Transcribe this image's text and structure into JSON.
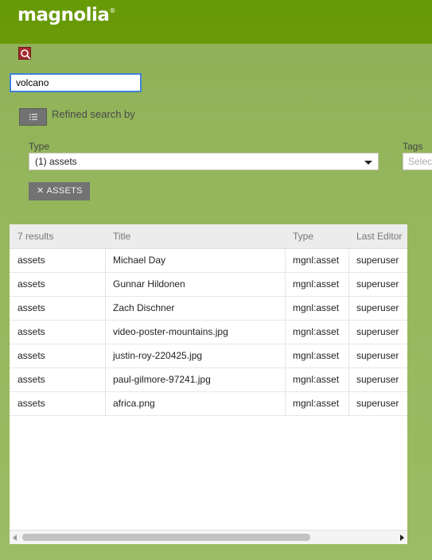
{
  "app": {
    "logo_text": "magnolia",
    "logo_mark": "®"
  },
  "search": {
    "value": "volcano"
  },
  "filters": {
    "toggle_icon": "list-icon",
    "refined_label": "Refined search by",
    "type_label": "Type",
    "type_value": "(1) assets",
    "tags_label": "Tags",
    "tags_placeholder": "Select",
    "active_chip": "ASSETS"
  },
  "results": {
    "columns": [
      "7 results",
      "Title",
      "Type",
      "Last Editor"
    ],
    "rows": [
      [
        "assets",
        "Michael Day",
        "mgnl:asset",
        "superuser"
      ],
      [
        "assets",
        "Gunnar Hildonen",
        "mgnl:asset",
        "superuser"
      ],
      [
        "assets",
        "Zach Dischner",
        "mgnl:asset",
        "superuser"
      ],
      [
        "assets",
        "video-poster-mountains.jpg",
        "mgnl:asset",
        "superuser"
      ],
      [
        "assets",
        "justin-roy-220425.jpg",
        "mgnl:asset",
        "superuser"
      ],
      [
        "assets",
        "paul-gilmore-97241.jpg",
        "mgnl:asset",
        "superuser"
      ],
      [
        "assets",
        "africa.png",
        "mgnl:asset",
        "superuser"
      ]
    ]
  },
  "colors": {
    "header_green": "#669a06",
    "search_accent": "#a52a30",
    "focus_blue": "#3f83d6"
  }
}
